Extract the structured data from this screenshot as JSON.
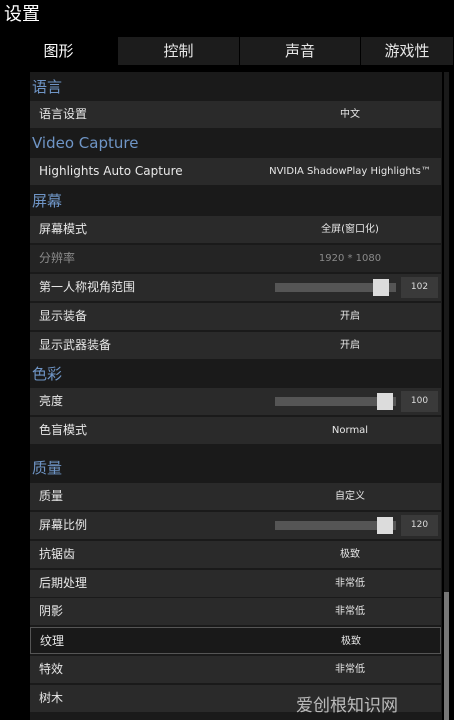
{
  "window": {
    "title": "设置"
  },
  "tabs": [
    {
      "label": "图形",
      "active": true
    },
    {
      "label": "控制",
      "active": false
    },
    {
      "label": "声音",
      "active": false
    },
    {
      "label": "游戏性",
      "active": false
    }
  ],
  "sections": {
    "language": "语言",
    "video_capture": "Video Capture",
    "screen": "屏幕",
    "color": "色彩",
    "quality": "质量"
  },
  "settings": {
    "language_setting": {
      "label": "语言设置",
      "value": "中文"
    },
    "highlights_capture": {
      "label": "Highlights Auto Capture",
      "value": "NVIDIA ShadowPlay Highlights™"
    },
    "screen_mode": {
      "label": "屏幕模式",
      "value": "全屏(窗口化)"
    },
    "resolution": {
      "label": "分辨率",
      "value": "1920 * 1080"
    },
    "fov": {
      "label": "第一人称视角范围",
      "value": "102",
      "fill": 0.93
    },
    "show_equipment": {
      "label": "显示装备",
      "value": "开启"
    },
    "show_weapon_equipment": {
      "label": "显示武器装备",
      "value": "开启"
    },
    "brightness": {
      "label": "亮度",
      "value": "100",
      "fill": 0.97
    },
    "colorblind_mode": {
      "label": "色盲模式",
      "value": "Normal"
    },
    "quality": {
      "label": "质量",
      "value": "自定义"
    },
    "screen_scale": {
      "label": "屏幕比例",
      "value": "120",
      "fill": 0.97
    },
    "anti_aliasing": {
      "label": "抗锯齿",
      "value": "极致"
    },
    "post_processing": {
      "label": "后期处理",
      "value": "非常低"
    },
    "shadows": {
      "label": "阴影",
      "value": "非常低"
    },
    "textures": {
      "label": "纹理",
      "value": "极致"
    },
    "effects": {
      "label": "特效",
      "value": "非常低"
    },
    "foliage": {
      "label": "树木",
      "value": ""
    }
  },
  "watermark": "爱创根知识网"
}
